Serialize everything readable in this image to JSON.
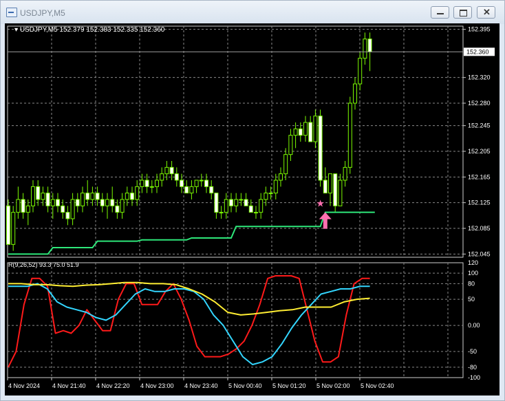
{
  "window": {
    "title": "USDJPY,M5",
    "icon": "chart-window-icon",
    "buttons": {
      "minimize": "minimize-icon",
      "maximize": "maximize-icon",
      "close": "close-icon"
    }
  },
  "chart": {
    "header": "USDJPY,M5  152.379 152.383 152.335 152.360",
    "current_price_label": "152.360",
    "current_price": 152.36,
    "colors": {
      "bull": "#7CFC00",
      "bear": "#ffffff",
      "stop_line": "#2ee87a",
      "grid": "#8a8a8a",
      "text": "#ffffff",
      "star": "#ff6fb0",
      "arrow": "#ff6fb0"
    }
  },
  "indicator": {
    "header": "R(9,26,52) 93.3 75.0 51.9",
    "colors": {
      "fast": "#ff1a1a",
      "mid": "#33d6ff",
      "slow": "#ffee33"
    }
  },
  "chart_data": {
    "type": "table",
    "price_axis": {
      "labels": [
        "152.395",
        "152.320",
        "152.280",
        "152.245",
        "152.205",
        "152.165",
        "152.125",
        "152.085",
        "152.045"
      ],
      "range": [
        152.04,
        152.4
      ]
    },
    "indicator_axis": {
      "labels": [
        "120",
        "100",
        "80",
        "50",
        "0.00",
        "-50",
        "-80",
        "-100"
      ],
      "range": [
        -100,
        120
      ]
    },
    "time_axis": {
      "labels": [
        "4 Nov 2024",
        "4 Nov 21:40",
        "4 Nov 22:20",
        "4 Nov 23:00",
        "4 Nov 23:40",
        "5 Nov 00:40",
        "5 Nov 01:20",
        "5 Nov 02:00",
        "5 Nov 02:40"
      ]
    },
    "candles": [
      [
        152.12,
        152.13,
        152.06,
        152.06
      ],
      [
        152.06,
        152.12,
        152.05,
        152.11
      ],
      [
        152.11,
        152.15,
        152.1,
        152.13
      ],
      [
        152.13,
        152.14,
        152.1,
        152.11
      ],
      [
        152.11,
        152.13,
        152.09,
        152.12
      ],
      [
        152.12,
        152.16,
        152.11,
        152.15
      ],
      [
        152.15,
        152.16,
        152.12,
        152.13
      ],
      [
        152.13,
        152.15,
        152.12,
        152.14
      ],
      [
        152.14,
        152.15,
        152.11,
        152.12
      ],
      [
        152.12,
        152.14,
        152.1,
        152.13
      ],
      [
        152.13,
        152.14,
        152.11,
        152.12
      ],
      [
        152.12,
        152.13,
        152.1,
        152.11
      ],
      [
        152.11,
        152.12,
        152.09,
        152.1
      ],
      [
        152.1,
        152.14,
        152.09,
        152.13
      ],
      [
        152.13,
        152.14,
        152.11,
        152.12
      ],
      [
        152.12,
        152.15,
        152.11,
        152.14
      ],
      [
        152.14,
        152.16,
        152.12,
        152.13
      ],
      [
        152.13,
        152.15,
        152.12,
        152.14
      ],
      [
        152.14,
        152.15,
        152.12,
        152.13
      ],
      [
        152.13,
        152.14,
        152.11,
        152.12
      ],
      [
        152.12,
        152.14,
        152.1,
        152.13
      ],
      [
        152.13,
        152.15,
        152.11,
        152.12
      ],
      [
        152.12,
        152.13,
        152.1,
        152.11
      ],
      [
        152.11,
        152.14,
        152.1,
        152.13
      ],
      [
        152.13,
        152.15,
        152.12,
        152.14
      ],
      [
        152.14,
        152.15,
        152.12,
        152.13
      ],
      [
        152.13,
        152.16,
        152.12,
        152.15
      ],
      [
        152.15,
        152.17,
        152.14,
        152.16
      ],
      [
        152.16,
        152.17,
        152.14,
        152.15
      ],
      [
        152.15,
        152.16,
        152.14,
        152.15
      ],
      [
        152.15,
        152.17,
        152.14,
        152.16
      ],
      [
        152.16,
        152.18,
        152.15,
        152.17
      ],
      [
        152.17,
        152.19,
        152.16,
        152.18
      ],
      [
        152.18,
        152.19,
        152.16,
        152.17
      ],
      [
        152.17,
        152.18,
        152.15,
        152.16
      ],
      [
        152.16,
        152.17,
        152.14,
        152.15
      ],
      [
        152.15,
        152.16,
        152.14,
        152.14
      ],
      [
        152.14,
        152.16,
        152.13,
        152.15
      ],
      [
        152.15,
        152.16,
        152.14,
        152.16
      ],
      [
        152.16,
        152.17,
        152.15,
        152.16
      ],
      [
        152.16,
        152.17,
        152.14,
        152.15
      ],
      [
        152.15,
        152.16,
        152.13,
        152.14
      ],
      [
        152.14,
        152.14,
        152.1,
        152.11
      ],
      [
        152.11,
        152.12,
        152.1,
        152.11
      ],
      [
        152.11,
        152.14,
        152.1,
        152.13
      ],
      [
        152.13,
        152.14,
        152.11,
        152.12
      ],
      [
        152.12,
        152.14,
        152.11,
        152.13
      ],
      [
        152.13,
        152.14,
        152.12,
        152.13
      ],
      [
        152.13,
        152.14,
        152.12,
        152.12
      ],
      [
        152.12,
        152.13,
        152.11,
        152.11
      ],
      [
        152.11,
        152.12,
        152.1,
        152.11
      ],
      [
        152.11,
        152.14,
        152.1,
        152.13
      ],
      [
        152.13,
        152.15,
        152.12,
        152.14
      ],
      [
        152.14,
        152.15,
        152.13,
        152.14
      ],
      [
        152.14,
        152.17,
        152.13,
        152.16
      ],
      [
        152.16,
        152.18,
        152.15,
        152.17
      ],
      [
        152.17,
        152.21,
        152.16,
        152.2
      ],
      [
        152.2,
        152.24,
        152.19,
        152.23
      ],
      [
        152.23,
        152.25,
        152.21,
        152.24
      ],
      [
        152.24,
        152.25,
        152.22,
        152.23
      ],
      [
        152.23,
        152.26,
        152.22,
        152.25
      ],
      [
        152.25,
        152.26,
        152.22,
        152.22
      ],
      [
        152.22,
        152.27,
        152.21,
        152.26
      ],
      [
        152.26,
        152.27,
        152.15,
        152.16
      ],
      [
        152.16,
        152.18,
        152.14,
        152.14
      ],
      [
        152.14,
        152.17,
        152.12,
        152.17
      ],
      [
        152.17,
        152.17,
        152.11,
        152.12
      ],
      [
        152.12,
        152.17,
        152.12,
        152.16
      ],
      [
        152.16,
        152.19,
        152.15,
        152.18
      ],
      [
        152.18,
        152.29,
        152.17,
        152.28
      ],
      [
        152.28,
        152.32,
        152.27,
        152.31
      ],
      [
        152.31,
        152.36,
        152.3,
        152.35
      ],
      [
        152.35,
        152.39,
        152.34,
        152.38
      ],
      [
        152.38,
        152.39,
        152.33,
        152.36
      ]
    ],
    "stop_line": [
      [
        0,
        152.045
      ],
      [
        8,
        152.045
      ],
      [
        9,
        152.055
      ],
      [
        17,
        152.055
      ],
      [
        18,
        152.065
      ],
      [
        26,
        152.065
      ],
      [
        27,
        152.067
      ],
      [
        36,
        152.067
      ],
      [
        37,
        152.07
      ],
      [
        45,
        152.07
      ],
      [
        46,
        152.088
      ],
      [
        63,
        152.088
      ],
      [
        64,
        152.11
      ],
      [
        74,
        152.11
      ]
    ],
    "signals": {
      "star_bar": 63,
      "star_price": 152.124,
      "arrow_bar": 64,
      "arrow_price": 152.095
    },
    "series": [
      {
        "values": [
          -80,
          -50,
          40,
          90,
          90,
          75,
          -15,
          -10,
          -15,
          0,
          30,
          10,
          -10,
          -10,
          50,
          80,
          80,
          40,
          40,
          40,
          65,
          80,
          50,
          10,
          -40,
          -60,
          -60,
          -60,
          -55,
          -45,
          -30,
          0,
          40,
          90,
          95,
          95,
          95,
          90,
          30,
          -30,
          -70,
          -70,
          -60,
          20,
          80,
          90,
          90
        ]
      },
      {
        "values": [
          75,
          75,
          75,
          80,
          70,
          45,
          35,
          30,
          25,
          15,
          10,
          20,
          40,
          60,
          70,
          65,
          65,
          70,
          70,
          65,
          50,
          20,
          0,
          -30,
          -60,
          -75,
          -70,
          -60,
          -35,
          -5,
          20,
          40,
          60,
          65,
          70,
          70,
          75,
          75
        ]
      },
      {
        "values": [
          80,
          80,
          78,
          78,
          76,
          75,
          77,
          78,
          80,
          82,
          82,
          80,
          80,
          78,
          70,
          60,
          45,
          25,
          20,
          22,
          25,
          28,
          30,
          35,
          35,
          35,
          45,
          50,
          52
        ]
      }
    ]
  }
}
